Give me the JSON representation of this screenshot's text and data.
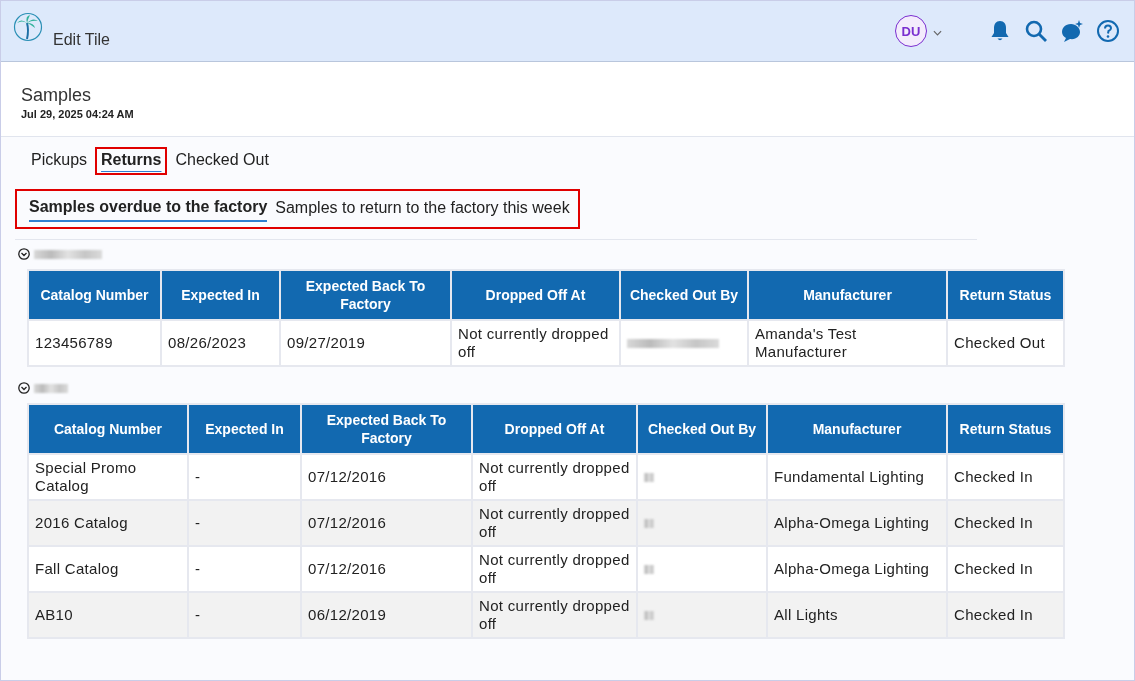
{
  "header": {
    "title": "Edit Tile",
    "avatar": "DU"
  },
  "page": {
    "title": "Samples",
    "timestamp": "Jul 29, 2025 04:24 AM"
  },
  "tabs": [
    {
      "label": "Pickups",
      "selected": false,
      "highlighted": false
    },
    {
      "label": "Returns",
      "selected": true,
      "highlighted": true
    },
    {
      "label": "Checked Out",
      "selected": false,
      "highlighted": false
    }
  ],
  "subtabs": {
    "highlighted": true,
    "items": [
      {
        "label": "Samples overdue to the factory",
        "selected": true
      },
      {
        "label": "Samples to return to the factory this week",
        "selected": false
      }
    ]
  },
  "groups": [
    {
      "expanded": true,
      "table": {
        "columns": [
          "Catalog Number",
          "Expected In",
          "Expected Back To Factory",
          "Dropped Off At",
          "Checked Out By",
          "Manufacturer",
          "Return Status"
        ],
        "rows": [
          [
            "123456789",
            "08/26/2023",
            "09/27/2019",
            "Not currently dropped off",
            "",
            "Amanda's Test Manufacturer",
            "Checked Out"
          ]
        ]
      }
    },
    {
      "expanded": true,
      "table": {
        "columns": [
          "Catalog Number",
          "Expected In",
          "Expected Back To Factory",
          "Dropped Off At",
          "Checked Out By",
          "Manufacturer",
          "Return Status"
        ],
        "rows": [
          [
            "Special Promo Catalog",
            "-",
            "07/12/2016",
            "Not currently dropped off",
            "",
            "Fundamental Lighting",
            "Checked In"
          ],
          [
            "2016 Catalog",
            "-",
            "07/12/2016",
            "Not currently dropped off",
            "",
            "Alpha-Omega Lighting",
            "Checked In"
          ],
          [
            "Fall Catalog",
            "-",
            "07/12/2016",
            "Not currently dropped off",
            "",
            "Alpha-Omega Lighting",
            "Checked In"
          ],
          [
            "AB10",
            "-",
            "06/12/2019",
            "Not currently dropped off",
            "",
            "All Lights",
            "Checked In"
          ]
        ]
      }
    }
  ]
}
